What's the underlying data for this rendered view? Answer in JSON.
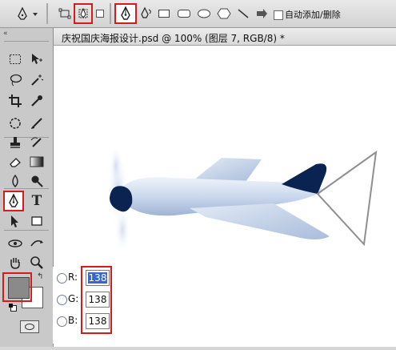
{
  "options_bar": {
    "tool_preset_icon": "pen-icon",
    "mode_shape_layers_icon": "shape-layers-icon",
    "mode_paths_icon": "paths-icon",
    "mode_fill_pixels_icon": "fill-pixels-icon",
    "pen_icon": "pen-icon",
    "freeform_pen_icon": "freeform-pen-icon",
    "rectangle_icon": "rectangle-icon",
    "rounded_rectangle_icon": "rounded-rectangle-icon",
    "ellipse_icon": "ellipse-icon",
    "polygon_icon": "polygon-icon",
    "line_icon": "line-icon",
    "custom_shape_icon": "custom-shape-icon",
    "auto_add_delete_label": "自动添加/删除"
  },
  "document": {
    "title": "庆祝国庆海报设计.psd @ 100% (图层 7, RGB/8) *"
  },
  "color_readout": {
    "channels": [
      {
        "label": "R:",
        "value": "138"
      },
      {
        "label": "G:",
        "value": "138"
      },
      {
        "label": "B:",
        "value": "138"
      }
    ]
  },
  "colors": {
    "foreground": "#8a8a8a",
    "highlight": "#d31d1d",
    "selection": "#3a67c8",
    "plane_body": "#c3d3ea",
    "plane_dark": "#0b2350"
  }
}
